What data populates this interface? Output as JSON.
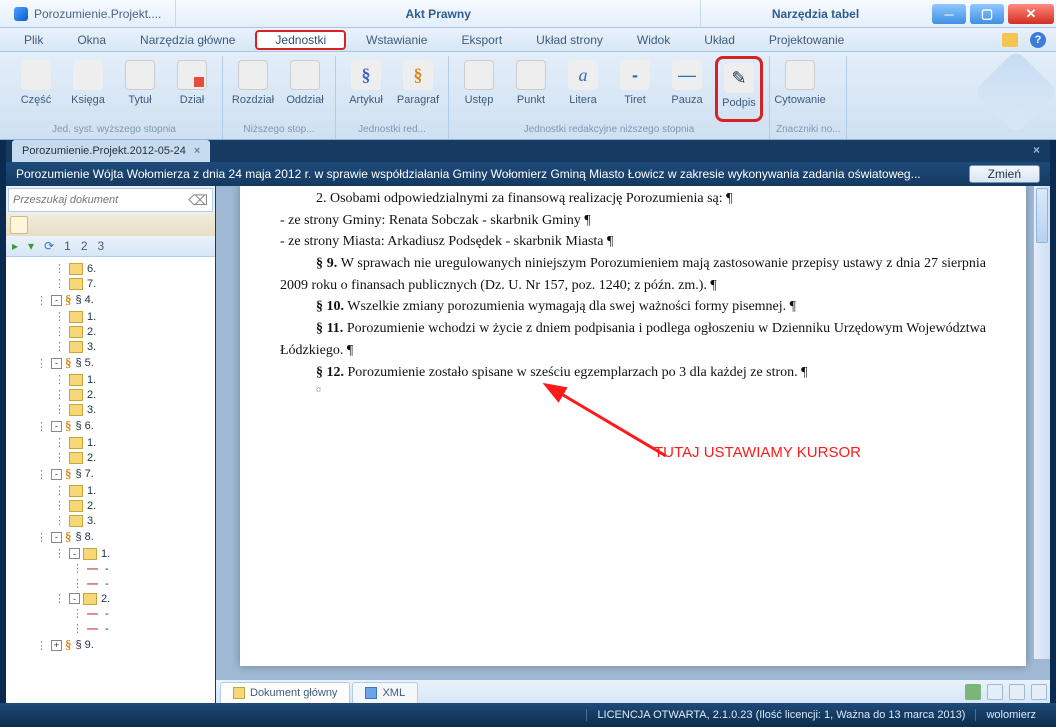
{
  "titlebar": {
    "app_tab": "Porozumienie.Projekt....",
    "center": "Akt Prawny",
    "right": "Narzędzia tabel"
  },
  "menu": {
    "items": [
      "Plik",
      "Okna",
      "Narzędzia główne",
      "Jednostki",
      "Wstawianie",
      "Eksport",
      "Układ strony",
      "Widok",
      "Układ",
      "Projektowanie"
    ],
    "active_index": 3
  },
  "ribbon": {
    "buttons": {
      "czesc": "Część",
      "ksiega": "Księga",
      "tytul": "Tytuł",
      "dzial": "Dział",
      "rozdzial": "Rozdział",
      "oddzial": "Oddział",
      "artykul": "Artykuł",
      "paragraf": "Paragraf",
      "ustep": "Ustęp",
      "punkt": "Punkt",
      "litera": "Litera",
      "tiret": "Tiret",
      "pauza": "Pauza",
      "podpis": "Podpis",
      "cytowanie": "Cytowanie"
    },
    "groups": {
      "g1": "Jed. syst. wyższego stopnia",
      "g2": "Niższego stop...",
      "g3": "Jednostki red...",
      "g4": "Jednostki redakcyjne niższego stopnia",
      "g5": "Znaczniki no..."
    }
  },
  "doc_tab": {
    "label": "Porozumienie.Projekt.2012-05-24"
  },
  "info_bar": {
    "text": "Porozumienie Wójta Wołomierza z dnia 24 maja 2012 r. w sprawie współdziałania Gminy Wołomierz Gminą Miasto Łowicz w zakresie wykonywania zadania oświatoweg...",
    "button": "Zmień"
  },
  "search": {
    "placeholder": "Przeszukaj dokument"
  },
  "nav_toolbar": {
    "nums": [
      "1",
      "2",
      "3"
    ]
  },
  "tree": [
    {
      "depth": 2,
      "icon": "sec",
      "label": "6."
    },
    {
      "depth": 2,
      "icon": "sec",
      "label": "7."
    },
    {
      "depth": 1,
      "exp": "-",
      "icon": "para",
      "label": "§ 4."
    },
    {
      "depth": 2,
      "icon": "sec",
      "label": "1."
    },
    {
      "depth": 2,
      "icon": "sec",
      "label": "2."
    },
    {
      "depth": 2,
      "icon": "sec",
      "label": "3."
    },
    {
      "depth": 1,
      "exp": "-",
      "icon": "para",
      "label": "§ 5."
    },
    {
      "depth": 2,
      "icon": "sec",
      "label": "1."
    },
    {
      "depth": 2,
      "icon": "sec",
      "label": "2."
    },
    {
      "depth": 2,
      "icon": "sec",
      "label": "3."
    },
    {
      "depth": 1,
      "exp": "-",
      "icon": "para",
      "label": "§ 6."
    },
    {
      "depth": 2,
      "icon": "sec",
      "label": "1."
    },
    {
      "depth": 2,
      "icon": "sec",
      "label": "2."
    },
    {
      "depth": 1,
      "exp": "-",
      "icon": "para",
      "label": "§ 7."
    },
    {
      "depth": 2,
      "icon": "sec",
      "label": "1."
    },
    {
      "depth": 2,
      "icon": "sec",
      "label": "2."
    },
    {
      "depth": 2,
      "icon": "sec",
      "label": "3."
    },
    {
      "depth": 1,
      "exp": "-",
      "icon": "para",
      "label": "§ 8."
    },
    {
      "depth": 2,
      "exp": "-",
      "icon": "sec",
      "label": "1."
    },
    {
      "depth": 3,
      "icon": "dash",
      "label": "-"
    },
    {
      "depth": 3,
      "icon": "dash",
      "label": "-"
    },
    {
      "depth": 2,
      "exp": "-",
      "icon": "sec",
      "label": "2."
    },
    {
      "depth": 3,
      "icon": "dash",
      "label": "-"
    },
    {
      "depth": 3,
      "icon": "dash",
      "label": "-"
    },
    {
      "depth": 1,
      "exp": "+",
      "icon": "para",
      "label": "§ 9."
    }
  ],
  "document": {
    "p1": "2. Osobami odpowiedzialnymi za finansową realizację Porozumienia są: ¶",
    "p2": "- ze strony Gminy: Renata Sobczak - skarbnik Gminy ¶",
    "p3": "- ze strony Miasta: Arkadiusz Podsędek - skarbnik Miasta ¶",
    "p4": "§ 9. W sprawach nie uregulowanych niniejszym Porozumieniem mają zastosowanie przepisy ustawy z dnia 27 sierpnia 2009 roku o finansach publicznych (Dz. U. Nr 157, poz. 1240; z późn. zm.). ¶",
    "p5": "§ 10. Wszelkie zmiany porozumienia wymagają dla swej ważności formy pisemnej. ¶",
    "p6": "§ 11. Porozumienie wchodzi w życie z dniem podpisania i podlega ogłoszeniu w Dzienniku Urzędowym Województwa Łódzkiego. ¶",
    "p7": "§ 12. Porozumienie zostało spisane w sześciu egzemplarzach po 3 dla każdej ze stron. ¶"
  },
  "annotation": {
    "text": "TUTAJ USTAWIAMY KURSOR"
  },
  "bottom_tabs": {
    "main": "Dokument główny",
    "xml": "XML"
  },
  "statusbar": {
    "license": "LICENCJA OTWARTA, 2.1.0.23 (Ilość licencji: 1, Ważna do 13 marca 2013)",
    "user": "wolomierz"
  }
}
